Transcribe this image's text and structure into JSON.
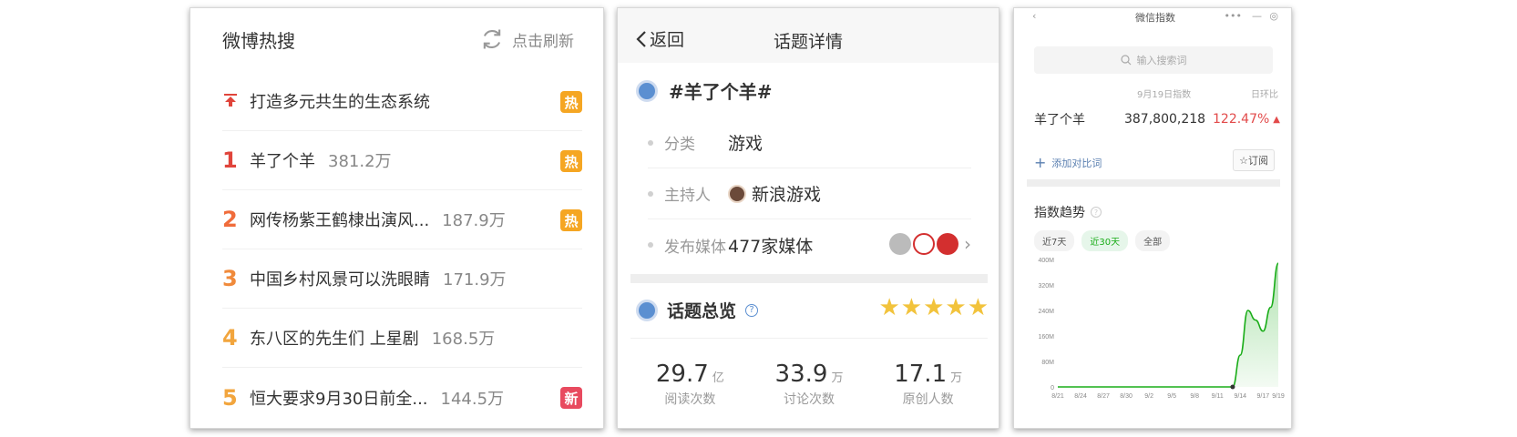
{
  "weibo": {
    "title": "微博热搜",
    "refresh_label": "点击刷新",
    "top_item": {
      "text": "打造多元共生的生态系统",
      "badge": "热"
    },
    "items": [
      {
        "rank": "1",
        "text": "羊了个羊",
        "count": "381.2万",
        "badge": "热",
        "badge_type": "hot"
      },
      {
        "rank": "2",
        "text": "网传杨紫王鹤棣出演风...",
        "count": "187.9万",
        "badge": "热",
        "badge_type": "hot"
      },
      {
        "rank": "3",
        "text": "中国乡村风景可以洗眼睛",
        "count": "171.9万",
        "badge": "",
        "badge_type": ""
      },
      {
        "rank": "4",
        "text": "东八区的先生们 上星剧",
        "count": "168.5万",
        "badge": "",
        "badge_type": ""
      },
      {
        "rank": "5",
        "text": "恒大要求9月30日前全...",
        "count": "144.5万",
        "badge": "新",
        "badge_type": "new"
      }
    ]
  },
  "topic": {
    "back_label": "返回",
    "nav_title": "话题详情",
    "topic_name": "#羊了个羊#",
    "category_label": "分类",
    "category_value": "游戏",
    "host_label": "主持人",
    "host_value": "新浪游戏",
    "media_label": "发布媒体",
    "media_value": "477家媒体",
    "overview_title": "话题总览",
    "help_glyph": "?",
    "stars": "★★★★★",
    "stats": [
      {
        "num": "29.7",
        "unit": "亿",
        "label": "阅读次数"
      },
      {
        "num": "33.9",
        "unit": "万",
        "label": "讨论次数"
      },
      {
        "num": "17.1",
        "unit": "万",
        "label": "原创人数"
      }
    ]
  },
  "wechat": {
    "nav_title": "微信指数",
    "search_placeholder": "输入搜索词",
    "date_header": "9月19日指数",
    "dod_header": "日环比",
    "keyword": "羊了个羊",
    "value": "387,800,218",
    "change": "122.47%",
    "change_arrow": "▲",
    "add_compare": "添加对比词",
    "subscribe": "☆订阅",
    "trend_title": "指数趋势",
    "tabs": [
      "近7天",
      "近30天",
      "全部"
    ],
    "active_tab": 1
  },
  "chart_data": {
    "type": "area",
    "title": "",
    "x": [
      "8/21",
      "8/22",
      "8/23",
      "8/24",
      "8/25",
      "8/26",
      "8/27",
      "8/28",
      "8/29",
      "8/30",
      "8/31",
      "9/1",
      "9/2",
      "9/3",
      "9/4",
      "9/5",
      "9/6",
      "9/7",
      "9/8",
      "9/9",
      "9/10",
      "9/11",
      "9/12",
      "9/13",
      "9/14",
      "9/15",
      "9/16",
      "9/17",
      "9/18",
      "9/19"
    ],
    "series": [
      {
        "values": [
          0,
          0,
          0,
          0,
          0,
          0,
          0,
          0,
          0,
          0,
          0,
          0,
          0,
          0,
          0,
          0,
          0,
          0,
          0,
          0,
          0,
          0,
          0,
          0,
          100,
          240,
          210,
          175,
          250,
          388
        ]
      }
    ],
    "x_ticks": [
      "8/21",
      "8/24",
      "8/27",
      "8/30",
      "9/2",
      "9/5",
      "9/8",
      "9/11",
      "9/14",
      "9/17",
      "9/19"
    ],
    "y_ticks": [
      0,
      80,
      160,
      240,
      320,
      400
    ],
    "y_tick_labels": [
      "0",
      "80M",
      "160M",
      "240M",
      "320M",
      "400M"
    ],
    "ylim": [
      0,
      400
    ],
    "color": "#1aad19",
    "grid": false
  }
}
